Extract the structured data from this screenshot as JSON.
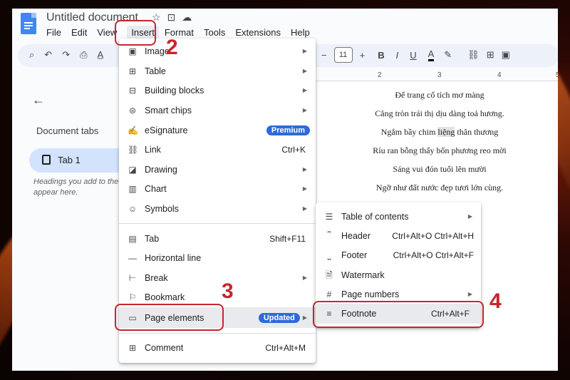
{
  "doc": {
    "title": "Untitled document",
    "star_icon": "star-icon",
    "move_icon": "move-folder-icon",
    "cloud_icon": "cloud-saved-icon"
  },
  "menubar": [
    "File",
    "Edit",
    "View",
    "Insert",
    "Format",
    "Tools",
    "Extensions",
    "Help"
  ],
  "toolbar": {
    "font_size": "11",
    "bold": "B",
    "italic": "I",
    "underline": "U",
    "text_color": "A"
  },
  "ruler": [
    "2",
    "3",
    "4",
    "5"
  ],
  "sidebar": {
    "title": "Document tabs",
    "tab_label": "Tab 1",
    "hint": "Headings you add to the will appear here."
  },
  "poem": [
    "Để trang cổ tích mơ màng",
    "Căng tròn trái thị dịu dàng toả hương.",
    "Ngắm bầy chim liệng thân thương",
    "Ríu ran bỗng thấy bốn phương reo mời",
    "Sáng vui đón tuổi lên mười",
    "Ngỡ như đất nước đẹp tươi lớn cùng."
  ],
  "insert_menu": {
    "image": "Image",
    "table": "Table",
    "building_blocks": "Building blocks",
    "smart_chips": "Smart chips",
    "esignature": "eSignature",
    "premium_badge": "Premium",
    "link": "Link",
    "link_shortcut": "Ctrl+K",
    "drawing": "Drawing",
    "chart": "Chart",
    "symbols": "Symbols",
    "tab": "Tab",
    "tab_shortcut": "Shift+F11",
    "horizontal_line": "Horizontal line",
    "break": "Break",
    "bookmark": "Bookmark",
    "page_elements": "Page elements",
    "updated_badge": "Updated",
    "comment": "Comment",
    "comment_shortcut": "Ctrl+Alt+M"
  },
  "page_elements_menu": {
    "toc": "Table of contents",
    "header": "Header",
    "header_shortcut": "Ctrl+Alt+O Ctrl+Alt+H",
    "footer": "Footer",
    "footer_shortcut": "Ctrl+Alt+O Ctrl+Alt+F",
    "watermark": "Watermark",
    "page_numbers": "Page numbers",
    "footnote": "Footnote",
    "footnote_shortcut": "Ctrl+Alt+F"
  },
  "annotations": {
    "step2": "2",
    "step3": "3",
    "step4": "4"
  },
  "colors": {
    "accent_red": "#c7252f",
    "badge_blue": "#2f6ad9",
    "tab_active": "#d3e3fd"
  }
}
